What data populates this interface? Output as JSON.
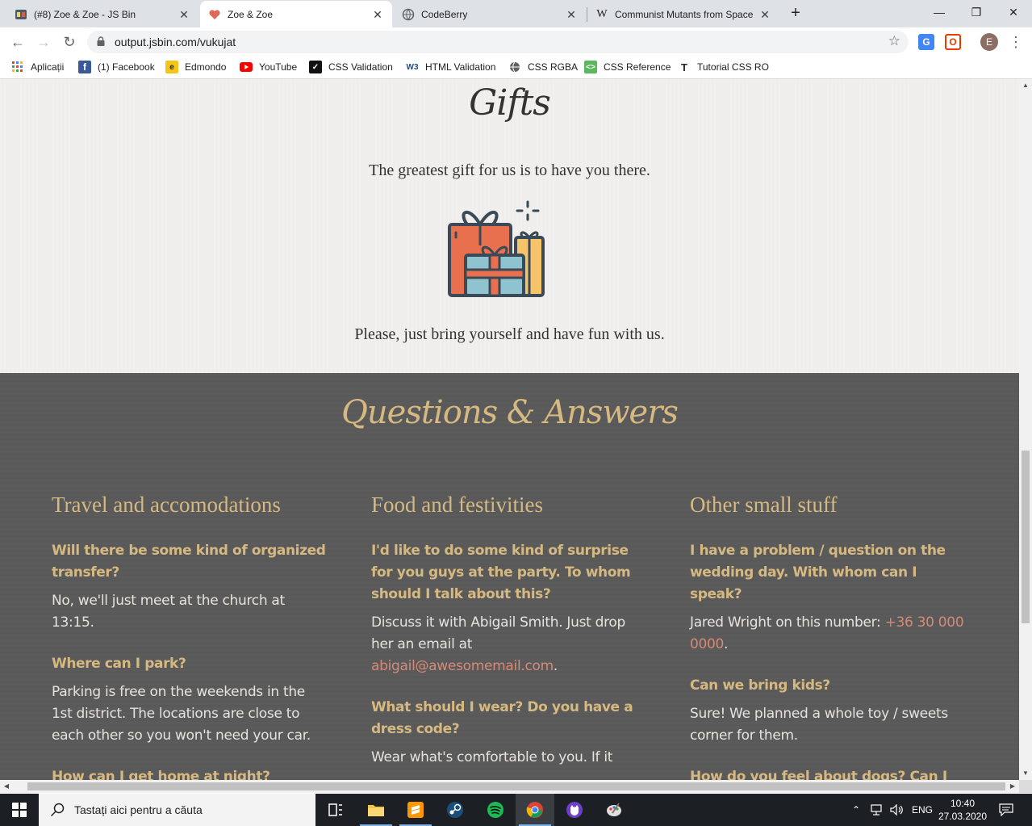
{
  "browser": {
    "tabs": [
      {
        "title": "(#8) Zoe & Zoe - JS Bin",
        "favicon": "jsbin-icon"
      },
      {
        "title": "Zoe & Zoe",
        "favicon": "heart-icon"
      },
      {
        "title": "CodeBerry",
        "favicon": "globe-icon"
      },
      {
        "title": "Communist Mutants from Space",
        "favicon": "wikipedia-icon"
      }
    ],
    "url": "output.jsbin.com/vukujat",
    "avatar_letter": "E",
    "bookmarks": [
      "Aplicații",
      "(1) Facebook",
      "Edmondo",
      "YouTube",
      "CSS Validation",
      "HTML Validation",
      "CSS RGBA",
      "CSS Reference",
      "Tutorial CSS RO"
    ]
  },
  "gifts": {
    "title": "Gifts",
    "line1": "The greatest gift for us is to have you there.",
    "line2": "Please, just bring yourself and have fun with us."
  },
  "qa": {
    "title": "Questions & Answers",
    "columns": [
      {
        "heading": "Travel and accomodations",
        "items": [
          {
            "q": "Will there be some kind of organized transfer?",
            "a": "No, we'll just meet at the church at 13:15."
          },
          {
            "q": "Where can I park?",
            "a": "Parking is free on the weekends in the 1st district. The locations are close to each other so you won't need your car."
          },
          {
            "q": "How can I get home at night?",
            "a": ""
          }
        ]
      },
      {
        "heading": "Food and festivities",
        "items": [
          {
            "q": "I'd like to do some kind of surprise for you guys at the party. To whom should I talk about this?",
            "a": "Discuss it with Abigail Smith. Just drop her an email at ",
            "link": "abigail@awesomemail.com",
            "after": "."
          },
          {
            "q": "What should I wear? Do you have a dress code?",
            "a": "Wear what's comfortable to you. If it"
          }
        ]
      },
      {
        "heading": "Other small stuff",
        "items": [
          {
            "q": "I have a problem / question on the wedding day. With whom can I speak?",
            "a": "Jared Wright on this number: ",
            "link": "+36 30 000 0000",
            "after": "."
          },
          {
            "q": "Can we bring kids?",
            "a": "Sure! We planned a whole toy / sweets corner for them."
          },
          {
            "q": "How do you feel about dogs? Can I bring mine?",
            "a": ""
          }
        ]
      }
    ]
  },
  "taskbar": {
    "search_placeholder": "Tastați aici pentru a căuta",
    "language": "ENG",
    "time": "10:40",
    "date": "27.03.2020"
  },
  "colors": {
    "accent_gold": "#d6b981",
    "link_coral": "#d58a77",
    "qa_background": "#5a5a5a",
    "gifts_background": "#f0efed"
  }
}
